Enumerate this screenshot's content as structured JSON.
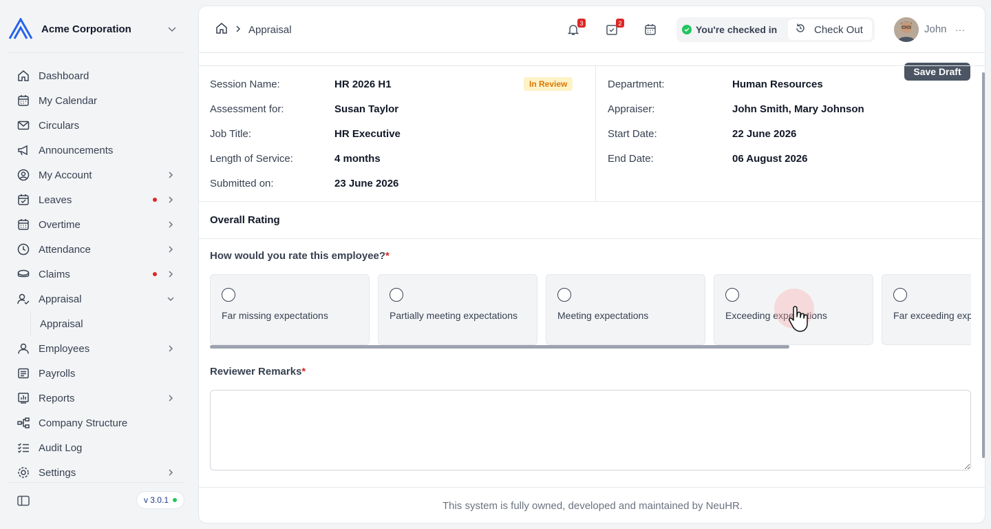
{
  "org": {
    "name": "Acme Corporation"
  },
  "sidebar": {
    "items": [
      {
        "label": "Dashboard",
        "icon": "home-icon"
      },
      {
        "label": "My Calendar",
        "icon": "calendar-icon"
      },
      {
        "label": "Circulars",
        "icon": "mail-icon"
      },
      {
        "label": "Announcements",
        "icon": "megaphone-icon"
      },
      {
        "label": "My Account",
        "icon": "user-circle-icon",
        "chevron": true
      },
      {
        "label": "Leaves",
        "icon": "calendar-check-icon",
        "chevron": true,
        "dot": true
      },
      {
        "label": "Overtime",
        "icon": "calendar-grid-icon",
        "chevron": true
      },
      {
        "label": "Attendance",
        "icon": "clock-icon",
        "chevron": true
      },
      {
        "label": "Claims",
        "icon": "coins-icon",
        "chevron": true,
        "dot": true
      },
      {
        "label": "Appraisal",
        "icon": "user-check-icon",
        "expanded": true
      },
      {
        "label": "Employees",
        "icon": "user-icon",
        "chevron": true
      },
      {
        "label": "Payrolls",
        "icon": "receipt-icon"
      },
      {
        "label": "Reports",
        "icon": "chart-icon",
        "chevron": true
      },
      {
        "label": "Company Structure",
        "icon": "structure-icon"
      },
      {
        "label": "Audit Log",
        "icon": "checklist-icon"
      },
      {
        "label": "Settings",
        "icon": "settings-icon",
        "chevron": true
      }
    ],
    "sub_item": "Appraisal",
    "version": "v 3.0.1"
  },
  "header": {
    "breadcrumb": "Appraisal",
    "notifications_count": "3",
    "messages_count": "2",
    "checkin_status": "You're checked in",
    "checkout_label": "Check Out",
    "user_name": "John"
  },
  "actions": {
    "save_draft": "Save Draft"
  },
  "details": {
    "left": [
      {
        "key": "Session Name:",
        "value": "HR 2026 H1"
      },
      {
        "key": "Assessment for:",
        "value": "Susan Taylor"
      },
      {
        "key": "Job Title:",
        "value": "HR Executive"
      },
      {
        "key": "Length of Service:",
        "value": "4 months"
      },
      {
        "key": "Submitted on:",
        "value": "23 June 2026"
      }
    ],
    "right": [
      {
        "key": "Department:",
        "value": "Human Resources"
      },
      {
        "key": "Appraiser:",
        "value": "John Smith, Mary Johnson"
      },
      {
        "key": "Start Date:",
        "value": "22 June 2026"
      },
      {
        "key": "End Date:",
        "value": "06 August 2026"
      }
    ],
    "status": "In Review"
  },
  "rating": {
    "section_title": "Overall Rating",
    "question": "How would you rate this employee?",
    "required_mark": "*",
    "options": [
      "Far missing expectations",
      "Partially meeting expectations",
      "Meeting expectations",
      "Exceeding expectations",
      "Far exceeding expectations"
    ]
  },
  "remarks": {
    "label": "Reviewer Remarks",
    "required_mark": "*",
    "value": ""
  },
  "footer": {
    "text": "This system is fully owned, developed and maintained by NeuHR."
  },
  "colors": {
    "accent": "#4b5563",
    "danger": "#dc2626",
    "success": "#22c55e",
    "warning": "#d97706"
  }
}
